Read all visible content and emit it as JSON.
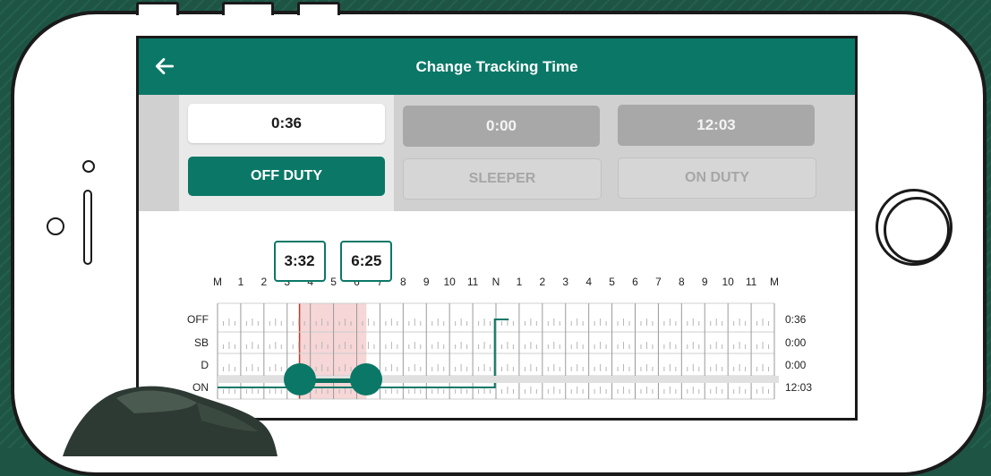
{
  "app": {
    "title": "Change Tracking Time",
    "back_icon": "arrow-left-icon"
  },
  "colors": {
    "accent": "#0b7867",
    "selection": "#f6d6d6",
    "selection_edge": "#c0392b"
  },
  "summary": {
    "off_duty": {
      "value": "0:36",
      "label": "OFF DUTY",
      "active": true
    },
    "sleeper": {
      "value": "0:00",
      "label": "SLEEPER",
      "active": false
    },
    "on_duty": {
      "value": "12:03",
      "label": "ON DUTY",
      "active": false
    }
  },
  "graph": {
    "hour_labels": [
      "M",
      "1",
      "2",
      "3",
      "4",
      "5",
      "6",
      "7",
      "8",
      "9",
      "10",
      "11",
      "N",
      "1",
      "2",
      "3",
      "4",
      "5",
      "6",
      "7",
      "8",
      "9",
      "10",
      "11",
      "M"
    ],
    "rows": [
      "OFF",
      "SB",
      "D",
      "ON"
    ],
    "totals": [
      "0:36",
      "0:00",
      "0:00",
      "12:03"
    ]
  },
  "selection": {
    "start_label": "3:32",
    "end_label": "6:25",
    "start_hours": 3.533,
    "end_hours": 6.417
  },
  "log": [
    {
      "status": "ON",
      "from": 0,
      "to": 11.95
    },
    {
      "status": "OFF",
      "from": 11.95,
      "to": 12.55
    }
  ]
}
